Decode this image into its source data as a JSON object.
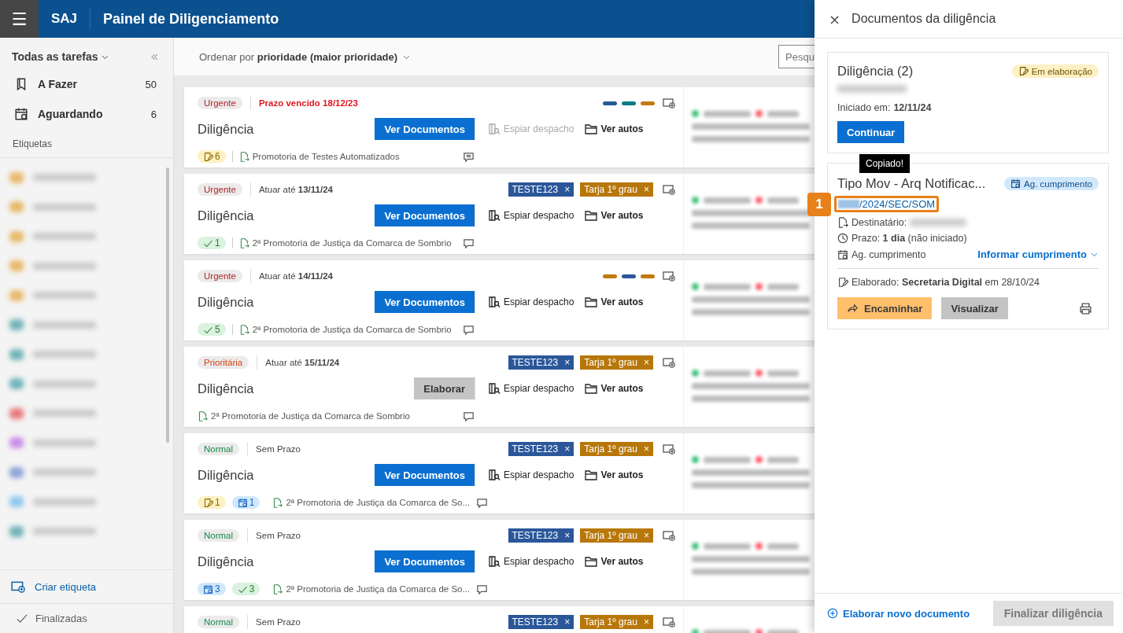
{
  "header": {
    "menu_icon": "☰",
    "brand": "SAJ",
    "title": "Painel de Diligenciamento"
  },
  "sidebar": {
    "filter": "Todas as tarefas",
    "items": [
      {
        "label": "A Fazer",
        "count": "50"
      },
      {
        "label": "Aguardando",
        "count": "6"
      }
    ],
    "labels_heading": "Etiquetas",
    "labels": [
      {
        "color": "#e8b86a"
      },
      {
        "color": "#e8b86a"
      },
      {
        "color": "#e8b86a"
      },
      {
        "color": "#e8b86a"
      },
      {
        "color": "#e8b86a"
      },
      {
        "color": "#6fb3b8"
      },
      {
        "color": "#6fb3b8"
      },
      {
        "color": "#6fb3b8"
      },
      {
        "color": "#e87a7a"
      },
      {
        "color": "#c98de8"
      },
      {
        "color": "#8fa3d8"
      },
      {
        "color": "#8ec8ef"
      },
      {
        "color": "#6fb3b8"
      }
    ],
    "create_label": "Criar etiqueta",
    "finished": "Finalizadas"
  },
  "toolbar": {
    "sort": "Ordenar por **prioridade (maior prioridade)**",
    "search": {
      "placeholder": "Pesqu"
    }
  },
  "cards": [
    {
      "priority": {
        "label": "Urgente",
        "kind": "urgent"
      },
      "deadline": "Prazo vencido 18/12/23",
      "overdue": true,
      "color_bars": [
        {
          "color": "#2b579a"
        },
        {
          "color": "#0e7c86"
        },
        {
          "color": "#c07a10"
        }
      ],
      "title": "Diligência",
      "action": {
        "label": "Ver Documentos",
        "kind": "primary"
      },
      "peek": {
        "label": "Espiar despacho",
        "disabled": true
      },
      "records": "Ver autos",
      "counters": [
        {
          "kind": "draft",
          "count": "6"
        }
      ],
      "org": "Promotoria de Testes Automatizados",
      "has_comments": true
    },
    {
      "priority": {
        "label": "Urgente",
        "kind": "urgent"
      },
      "deadline": "Atuar até **13/11/24**",
      "overdue": false,
      "tags": [
        {
          "label": "TESTE123",
          "remove": "×",
          "color": "#2b579a"
        },
        {
          "label": "Tarja 1º grau",
          "remove": "×",
          "color": "#b8770a"
        }
      ],
      "title": "Diligência",
      "action": {
        "label": "Ver Documentos",
        "kind": "primary"
      },
      "peek": {
        "label": "Espiar despacho",
        "disabled": false
      },
      "records": "Ver autos",
      "counters": [
        {
          "kind": "done",
          "count": "1"
        }
      ],
      "org": "2ª Promotoria de Justiça da Comarca de Sombrio",
      "has_comments": false
    },
    {
      "priority": {
        "label": "Urgente",
        "kind": "urgent"
      },
      "deadline": "Atuar até **14/11/24**",
      "overdue": false,
      "color_bars": [
        {
          "color": "#c07a10"
        },
        {
          "color": "#2b579a"
        },
        {
          "color": "#c07a10"
        }
      ],
      "title": "Diligência",
      "action": {
        "label": "Ver Documentos",
        "kind": "primary"
      },
      "peek": {
        "label": "Espiar despacho",
        "disabled": false
      },
      "records": "Ver autos",
      "counters": [
        {
          "kind": "done",
          "count": "5"
        }
      ],
      "org": "2ª Promotoria de Justiça da Comarca de Sombrio",
      "has_comments": false
    },
    {
      "priority": {
        "label": "Prioritária",
        "kind": "priority"
      },
      "deadline": "Atuar até **15/11/24**",
      "overdue": false,
      "tags": [
        {
          "label": "TESTE123",
          "remove": "×",
          "color": "#2b579a"
        },
        {
          "label": "Tarja 1º grau",
          "remove": "×",
          "color": "#b8770a"
        }
      ],
      "title": "Diligência",
      "action": {
        "label": "Elaborar",
        "kind": "secondary"
      },
      "peek": {
        "label": "Espiar despacho",
        "disabled": false
      },
      "records": "Ver autos",
      "org": "2ª Promotoria de Justiça da Comarca de Sombrio",
      "has_comments": false
    },
    {
      "priority": {
        "label": "Normal",
        "kind": "normal"
      },
      "deadline": "Sem Prazo",
      "overdue": false,
      "tags": [
        {
          "label": "TESTE123",
          "remove": "×",
          "color": "#2b579a"
        },
        {
          "label": "Tarja 1º grau",
          "remove": "×",
          "color": "#b8770a"
        }
      ],
      "title": "Diligência",
      "action": {
        "label": "Ver Documentos",
        "kind": "primary"
      },
      "peek": {
        "label": "Espiar despacho",
        "disabled": false
      },
      "records": "Ver autos",
      "counters": [
        {
          "kind": "draft",
          "count": "1"
        },
        {
          "kind": "waiting",
          "count": "1"
        }
      ],
      "org": "2ª Promotoria de Justiça da Comarca de So...",
      "has_comments": false
    },
    {
      "priority": {
        "label": "Normal",
        "kind": "normal"
      },
      "deadline": "Sem Prazo",
      "overdue": false,
      "tags": [
        {
          "label": "TESTE123",
          "remove": "×",
          "color": "#2b579a"
        },
        {
          "label": "Tarja 1º grau",
          "remove": "×",
          "color": "#b8770a"
        }
      ],
      "title": "Diligência",
      "action": {
        "label": "Ver Documentos",
        "kind": "primary"
      },
      "peek": {
        "label": "Espiar despacho",
        "disabled": false
      },
      "records": "Ver autos",
      "counters": [
        {
          "kind": "waiting",
          "count": "3"
        },
        {
          "kind": "done",
          "count": "3"
        }
      ],
      "org": "2ª Promotoria de Justiça da Comarca de So...",
      "has_comments": false
    },
    {
      "priority": {
        "label": "Normal",
        "kind": "normal"
      },
      "deadline": "Sem Prazo",
      "overdue": false,
      "tags": [
        {
          "label": "TESTE123",
          "remove": "×",
          "color": "#2b579a"
        },
        {
          "label": "Tarja 1º grau",
          "remove": "×",
          "color": "#b8770a"
        }
      ]
    }
  ],
  "drawer": {
    "close": "×",
    "title": "Documentos da diligência",
    "draft": {
      "title": "Diligência (2)",
      "status": {
        "label": "Em elaboração",
        "kind": "draft"
      },
      "started": "Iniciado em: **12/11/24**",
      "button": "Continuar"
    },
    "document": {
      "tooltip": "Copiado!",
      "title": "Tipo Mov - Arq Notificac...",
      "status": {
        "label": "Ag. cumprimento",
        "kind": "waiting"
      },
      "code": "/2024/SEC/SOM",
      "callout": "1",
      "recipient": "Destinatário:",
      "deadline": "Prazo: **1 dia** (não iniciado)",
      "state": "Ag. cumprimento",
      "inform": "Informar cumprimento",
      "elaborated": "Elaborado: **Secretaria Digital** em 28/10/24",
      "forward": "Encaminhar",
      "view": "Visualizar"
    },
    "new_document": "Elaborar novo documento",
    "finish": {
      "label": "Finalizar diligência",
      "disabled": true
    }
  }
}
